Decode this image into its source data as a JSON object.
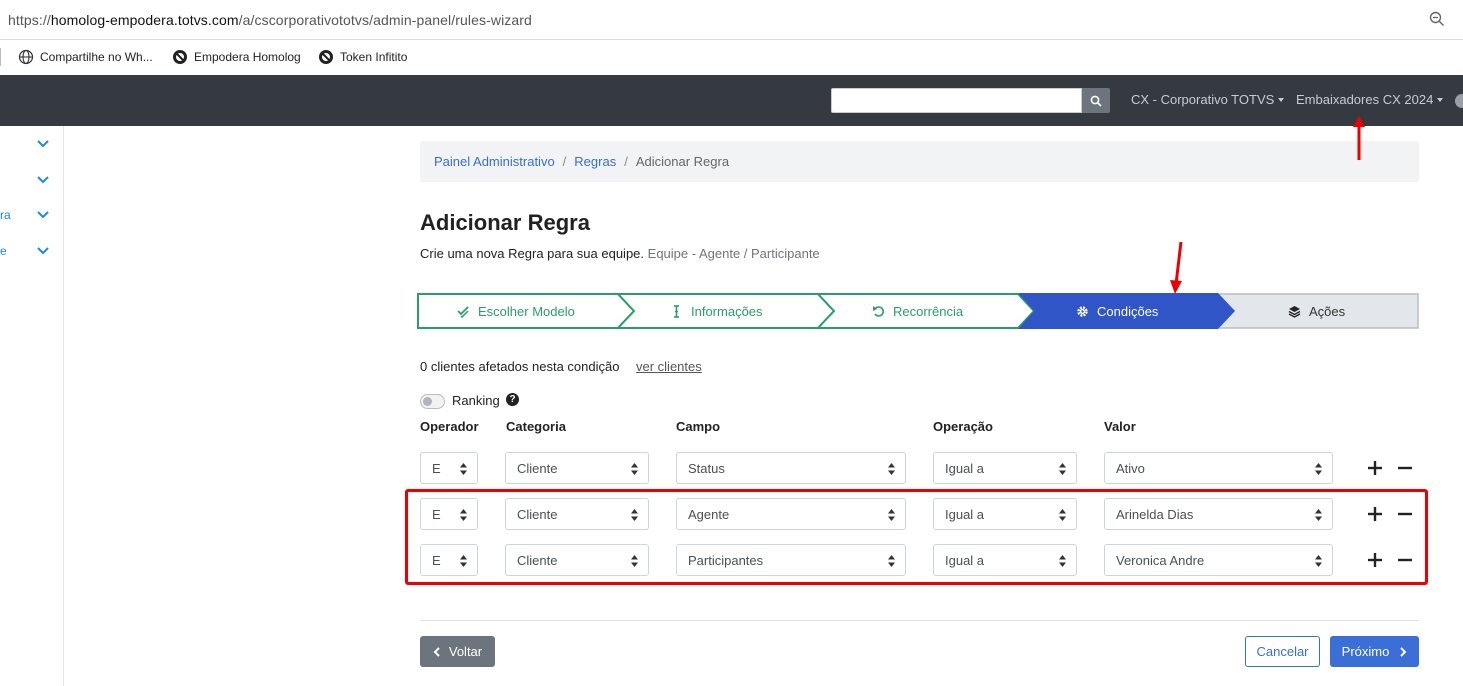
{
  "browser": {
    "url_prefix": "https://",
    "url_host": "homolog-empodera.totvs.com",
    "url_path": "/a/cscorporativototvs/admin-panel/rules-wizard",
    "bookmarks": [
      "Compartilhe no Wh...",
      "Empodera Homolog",
      "Token Infitito"
    ]
  },
  "topnav": {
    "search_value": "",
    "company": "CX - Corporativo TOTVS",
    "program": "Embaixadores CX 2024"
  },
  "sidebar": {
    "items": [
      {
        "label": ""
      },
      {
        "label": ""
      },
      {
        "label": "ra"
      },
      {
        "label": "e"
      }
    ]
  },
  "breadcrumb": {
    "items": [
      "Painel Administrativo",
      "Regras"
    ],
    "current": "Adicionar Regra",
    "separator": "/"
  },
  "page": {
    "title": "Adicionar Regra",
    "subtitle": "Crie uma nova Regra para sua equipe.",
    "subtitle_muted": "Equipe - Agente / Participante"
  },
  "steps": [
    {
      "label": "Escolher Modelo",
      "icon": "check-double-icon",
      "state": "done"
    },
    {
      "label": "Informações",
      "icon": "text-cursor-icon",
      "state": "done"
    },
    {
      "label": "Recorrência",
      "icon": "undo-icon",
      "state": "done"
    },
    {
      "label": "Condições",
      "icon": "gear-icon",
      "state": "active"
    },
    {
      "label": "Ações",
      "icon": "layers-icon",
      "state": "pending"
    }
  ],
  "conditions": {
    "affected_text": "0 clientes afetados nesta condição",
    "view_link": "ver clientes",
    "ranking_label": "Ranking",
    "ranking_enabled": false,
    "headers": {
      "operador": "Operador",
      "categoria": "Categoria",
      "campo": "Campo",
      "operacao": "Operação",
      "valor": "Valor"
    },
    "rows": [
      {
        "operador": "E",
        "categoria": "Cliente",
        "campo": "Status",
        "operacao": "Igual a",
        "valor": "Ativo"
      },
      {
        "operador": "E",
        "categoria": "Cliente",
        "campo": "Agente",
        "operacao": "Igual a",
        "valor": "Arinelda Dias"
      },
      {
        "operador": "E",
        "categoria": "Cliente",
        "campo": "Participantes",
        "operacao": "Igual a",
        "valor": "Veronica Andre"
      }
    ]
  },
  "footer": {
    "back_label": "Voltar",
    "cancel_label": "Cancelar",
    "next_label": "Próximo"
  },
  "colors": {
    "navbar": "#343a40",
    "step_done": "#2a9d6f",
    "step_active": "#2f55c6",
    "step_pending": "#e3e6ea",
    "annotation": "#e00000",
    "primary": "#3a6fd8"
  }
}
